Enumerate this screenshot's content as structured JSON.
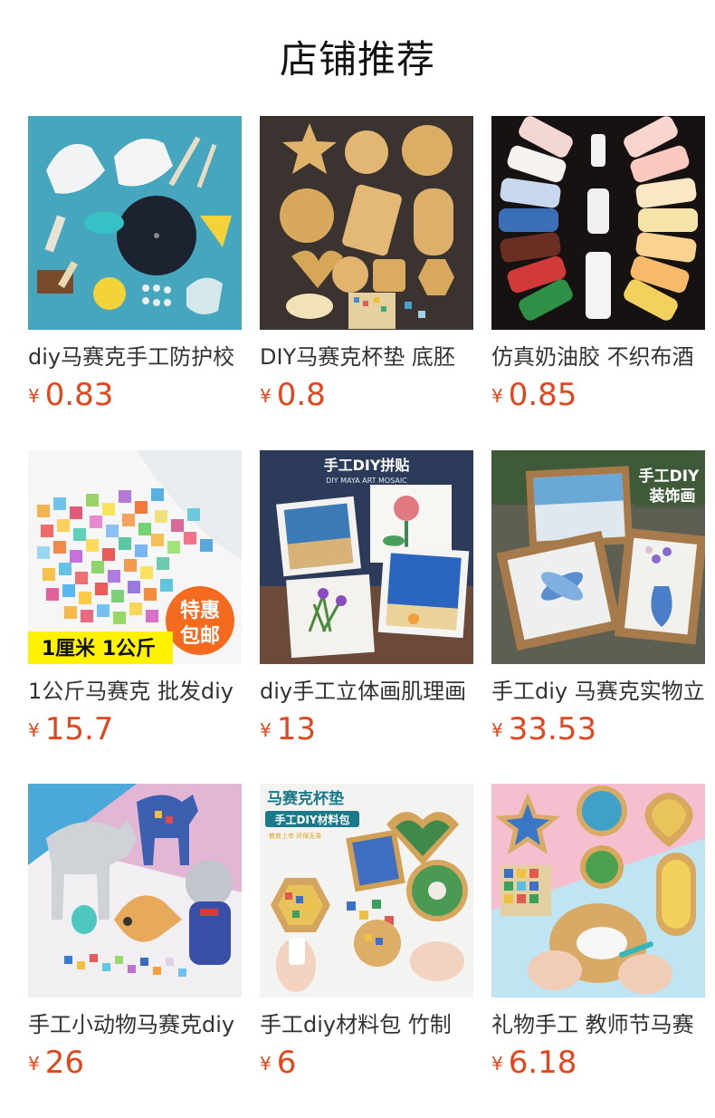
{
  "title": "店铺推荐",
  "currency": "¥",
  "products": [
    {
      "name": "diy马赛克手工防护校",
      "price": "0.83",
      "image": "gloves-tools-kit-image"
    },
    {
      "name": "DIY马赛克杯垫 底胚",
      "price": "0.8",
      "image": "bamboo-coaster-bases-image"
    },
    {
      "name": "仿真奶油胶 不织布酒",
      "price": "0.85",
      "image": "cream-glue-tubes-image"
    },
    {
      "name": "1公斤马赛克 批发diy",
      "price": "15.7",
      "image": "glass-mosaic-tiles-bag-image",
      "overlay": {
        "badge": "1厘米 1公斤",
        "promo_line1": "特惠",
        "promo_line2": "包邮"
      }
    },
    {
      "name": "diy手工立体画肌理画",
      "price": "13",
      "image": "mosaic-art-panels-image",
      "overlay": {
        "heading": "手工DIY拼贴",
        "subheading": "DIY MAYA ART MOSAIC"
      }
    },
    {
      "name": "手工diy 马赛克实物立",
      "price": "33.53",
      "image": "framed-mosaic-paintings-image",
      "overlay": {
        "line1": "手工DIY",
        "line2": "装饰画"
      }
    },
    {
      "name": "手工小动物马赛克diy",
      "price": "26",
      "image": "mosaic-animal-figures-image"
    },
    {
      "name": "手工diy材料包 竹制",
      "price": "6",
      "image": "mosaic-coaster-kit-image",
      "overlay": {
        "heading": "马赛克杯垫",
        "subheading": "手工DIY材料包",
        "small": "教育上市 环保无毒"
      }
    },
    {
      "name": "礼物手工 教师节马赛",
      "price": "6.18",
      "image": "mosaic-coaster-gift-image"
    }
  ]
}
